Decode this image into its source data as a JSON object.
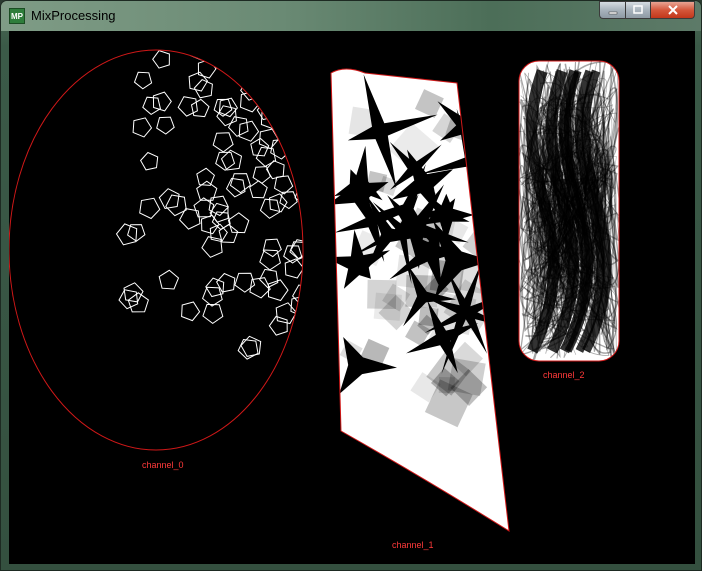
{
  "window": {
    "title": "MixProcessing",
    "icon_label": "MP",
    "buttons": {
      "minimize": "minimize-icon",
      "maximize": "maximize-icon",
      "close": "close-icon"
    }
  },
  "channels": [
    {
      "label": "channel_0"
    },
    {
      "label": "channel_1"
    },
    {
      "label": "channel_2"
    }
  ],
  "colors": {
    "mask_outline": "#ff2a2a",
    "canvas_bg": "#000000"
  }
}
